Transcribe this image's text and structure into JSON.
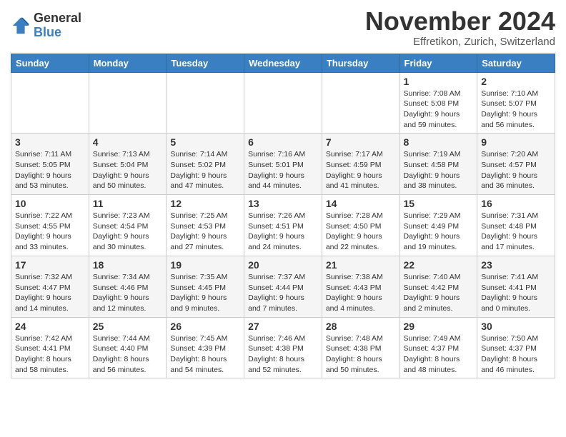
{
  "logo": {
    "general": "General",
    "blue": "Blue"
  },
  "title": "November 2024",
  "subtitle": "Effretikon, Zurich, Switzerland",
  "days_header": [
    "Sunday",
    "Monday",
    "Tuesday",
    "Wednesday",
    "Thursday",
    "Friday",
    "Saturday"
  ],
  "weeks": [
    [
      {
        "day": "",
        "info": ""
      },
      {
        "day": "",
        "info": ""
      },
      {
        "day": "",
        "info": ""
      },
      {
        "day": "",
        "info": ""
      },
      {
        "day": "",
        "info": ""
      },
      {
        "day": "1",
        "info": "Sunrise: 7:08 AM\nSunset: 5:08 PM\nDaylight: 9 hours and 59 minutes."
      },
      {
        "day": "2",
        "info": "Sunrise: 7:10 AM\nSunset: 5:07 PM\nDaylight: 9 hours and 56 minutes."
      }
    ],
    [
      {
        "day": "3",
        "info": "Sunrise: 7:11 AM\nSunset: 5:05 PM\nDaylight: 9 hours and 53 minutes."
      },
      {
        "day": "4",
        "info": "Sunrise: 7:13 AM\nSunset: 5:04 PM\nDaylight: 9 hours and 50 minutes."
      },
      {
        "day": "5",
        "info": "Sunrise: 7:14 AM\nSunset: 5:02 PM\nDaylight: 9 hours and 47 minutes."
      },
      {
        "day": "6",
        "info": "Sunrise: 7:16 AM\nSunset: 5:01 PM\nDaylight: 9 hours and 44 minutes."
      },
      {
        "day": "7",
        "info": "Sunrise: 7:17 AM\nSunset: 4:59 PM\nDaylight: 9 hours and 41 minutes."
      },
      {
        "day": "8",
        "info": "Sunrise: 7:19 AM\nSunset: 4:58 PM\nDaylight: 9 hours and 38 minutes."
      },
      {
        "day": "9",
        "info": "Sunrise: 7:20 AM\nSunset: 4:57 PM\nDaylight: 9 hours and 36 minutes."
      }
    ],
    [
      {
        "day": "10",
        "info": "Sunrise: 7:22 AM\nSunset: 4:55 PM\nDaylight: 9 hours and 33 minutes."
      },
      {
        "day": "11",
        "info": "Sunrise: 7:23 AM\nSunset: 4:54 PM\nDaylight: 9 hours and 30 minutes."
      },
      {
        "day": "12",
        "info": "Sunrise: 7:25 AM\nSunset: 4:53 PM\nDaylight: 9 hours and 27 minutes."
      },
      {
        "day": "13",
        "info": "Sunrise: 7:26 AM\nSunset: 4:51 PM\nDaylight: 9 hours and 24 minutes."
      },
      {
        "day": "14",
        "info": "Sunrise: 7:28 AM\nSunset: 4:50 PM\nDaylight: 9 hours and 22 minutes."
      },
      {
        "day": "15",
        "info": "Sunrise: 7:29 AM\nSunset: 4:49 PM\nDaylight: 9 hours and 19 minutes."
      },
      {
        "day": "16",
        "info": "Sunrise: 7:31 AM\nSunset: 4:48 PM\nDaylight: 9 hours and 17 minutes."
      }
    ],
    [
      {
        "day": "17",
        "info": "Sunrise: 7:32 AM\nSunset: 4:47 PM\nDaylight: 9 hours and 14 minutes."
      },
      {
        "day": "18",
        "info": "Sunrise: 7:34 AM\nSunset: 4:46 PM\nDaylight: 9 hours and 12 minutes."
      },
      {
        "day": "19",
        "info": "Sunrise: 7:35 AM\nSunset: 4:45 PM\nDaylight: 9 hours and 9 minutes."
      },
      {
        "day": "20",
        "info": "Sunrise: 7:37 AM\nSunset: 4:44 PM\nDaylight: 9 hours and 7 minutes."
      },
      {
        "day": "21",
        "info": "Sunrise: 7:38 AM\nSunset: 4:43 PM\nDaylight: 9 hours and 4 minutes."
      },
      {
        "day": "22",
        "info": "Sunrise: 7:40 AM\nSunset: 4:42 PM\nDaylight: 9 hours and 2 minutes."
      },
      {
        "day": "23",
        "info": "Sunrise: 7:41 AM\nSunset: 4:41 PM\nDaylight: 9 hours and 0 minutes."
      }
    ],
    [
      {
        "day": "24",
        "info": "Sunrise: 7:42 AM\nSunset: 4:41 PM\nDaylight: 8 hours and 58 minutes."
      },
      {
        "day": "25",
        "info": "Sunrise: 7:44 AM\nSunset: 4:40 PM\nDaylight: 8 hours and 56 minutes."
      },
      {
        "day": "26",
        "info": "Sunrise: 7:45 AM\nSunset: 4:39 PM\nDaylight: 8 hours and 54 minutes."
      },
      {
        "day": "27",
        "info": "Sunrise: 7:46 AM\nSunset: 4:38 PM\nDaylight: 8 hours and 52 minutes."
      },
      {
        "day": "28",
        "info": "Sunrise: 7:48 AM\nSunset: 4:38 PM\nDaylight: 8 hours and 50 minutes."
      },
      {
        "day": "29",
        "info": "Sunrise: 7:49 AM\nSunset: 4:37 PM\nDaylight: 8 hours and 48 minutes."
      },
      {
        "day": "30",
        "info": "Sunrise: 7:50 AM\nSunset: 4:37 PM\nDaylight: 8 hours and 46 minutes."
      }
    ]
  ]
}
